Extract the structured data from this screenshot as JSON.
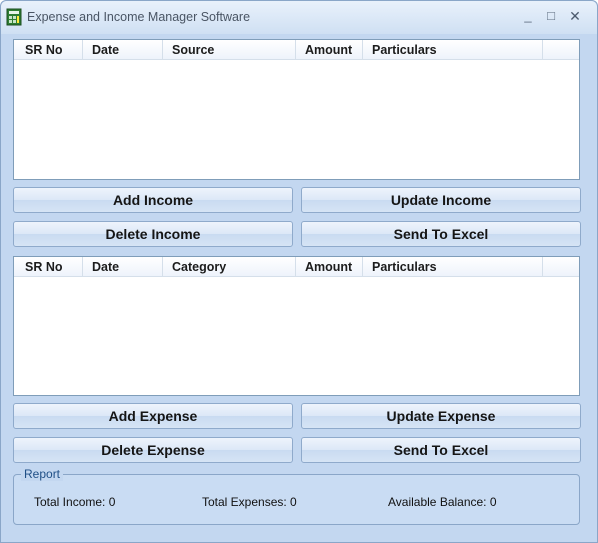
{
  "window": {
    "title": "Expense and Income Manager Software",
    "minimize_glyph": "_",
    "maximize_glyph": "□",
    "close_glyph": "✕"
  },
  "income_list": {
    "columns": [
      "SR No",
      "Date",
      "Source",
      "Amount",
      "Particulars",
      ""
    ],
    "rows": []
  },
  "income_buttons": {
    "add": "Add Income",
    "update": "Update Income",
    "delete": "Delete Income",
    "excel": "Send To Excel"
  },
  "expense_list": {
    "columns": [
      "SR No",
      "Date",
      "Category",
      "Amount",
      "Particulars",
      ""
    ],
    "rows": []
  },
  "expense_buttons": {
    "add": "Add Expense",
    "update": "Update Expense",
    "delete": "Delete Expense",
    "excel": "Send To Excel"
  },
  "report": {
    "legend": "Report",
    "total_income": "Total Income: 0",
    "total_expenses": "Total Expenses: 0",
    "available_balance": "Available Balance: 0"
  },
  "colors": {
    "window_bg": "#c3d7f0",
    "accent": "#1f4f86"
  }
}
